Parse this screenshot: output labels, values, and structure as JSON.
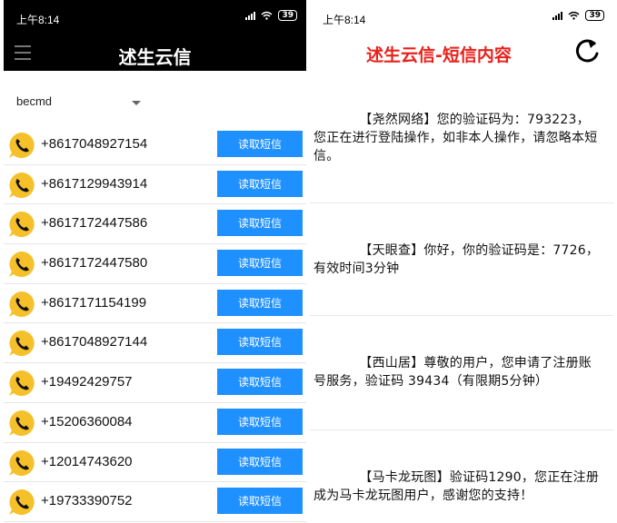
{
  "status_bar": {
    "time": "上午8:14",
    "battery": "39"
  },
  "left_screen": {
    "app_title": "述生云信",
    "account": "becmd",
    "contacts": [
      {
        "phone": "+8617048927154",
        "button": "读取短信"
      },
      {
        "phone": "+8617129943914",
        "button": "读取短信"
      },
      {
        "phone": "+8617172447586",
        "button": "读取短信"
      },
      {
        "phone": "+8617172447580",
        "button": "读取短信"
      },
      {
        "phone": "+8617171154199",
        "button": "读取短信"
      },
      {
        "phone": "+8617048927144",
        "button": "读取短信"
      },
      {
        "phone": "+19492429757",
        "button": "读取短信"
      },
      {
        "phone": "+15206360084",
        "button": "读取短信"
      },
      {
        "phone": "+12014743620",
        "button": "读取短信"
      },
      {
        "phone": "+19733390752",
        "button": "读取短信"
      }
    ]
  },
  "right_screen": {
    "title": "述生云信-短信内容",
    "messages": [
      "【尧然网络】您的验证码为：793223，您正在进行登陆操作，如非本人操作，请忽略本短信。",
      "【天眼查】你好，你的验证码是：7726，有效时间3分钟",
      "【西山居】尊敬的用户，您申请了注册账号服务，验证码 39434（有限期5分钟）",
      "【马卡龙玩图】验证码1290，您正在注册成为马卡龙玩图用户，感谢您的支持！"
    ]
  },
  "colors": {
    "accent": "#1e90ff",
    "title_red": "#e8211c",
    "avatar_yellow": "#f5c02a",
    "bar": "#000000"
  },
  "icons": [
    "signal-icon",
    "wifi-icon",
    "battery-icon",
    "menu-icon",
    "dropdown-arrow-icon",
    "phone-avatar-icon",
    "refresh-icon"
  ]
}
